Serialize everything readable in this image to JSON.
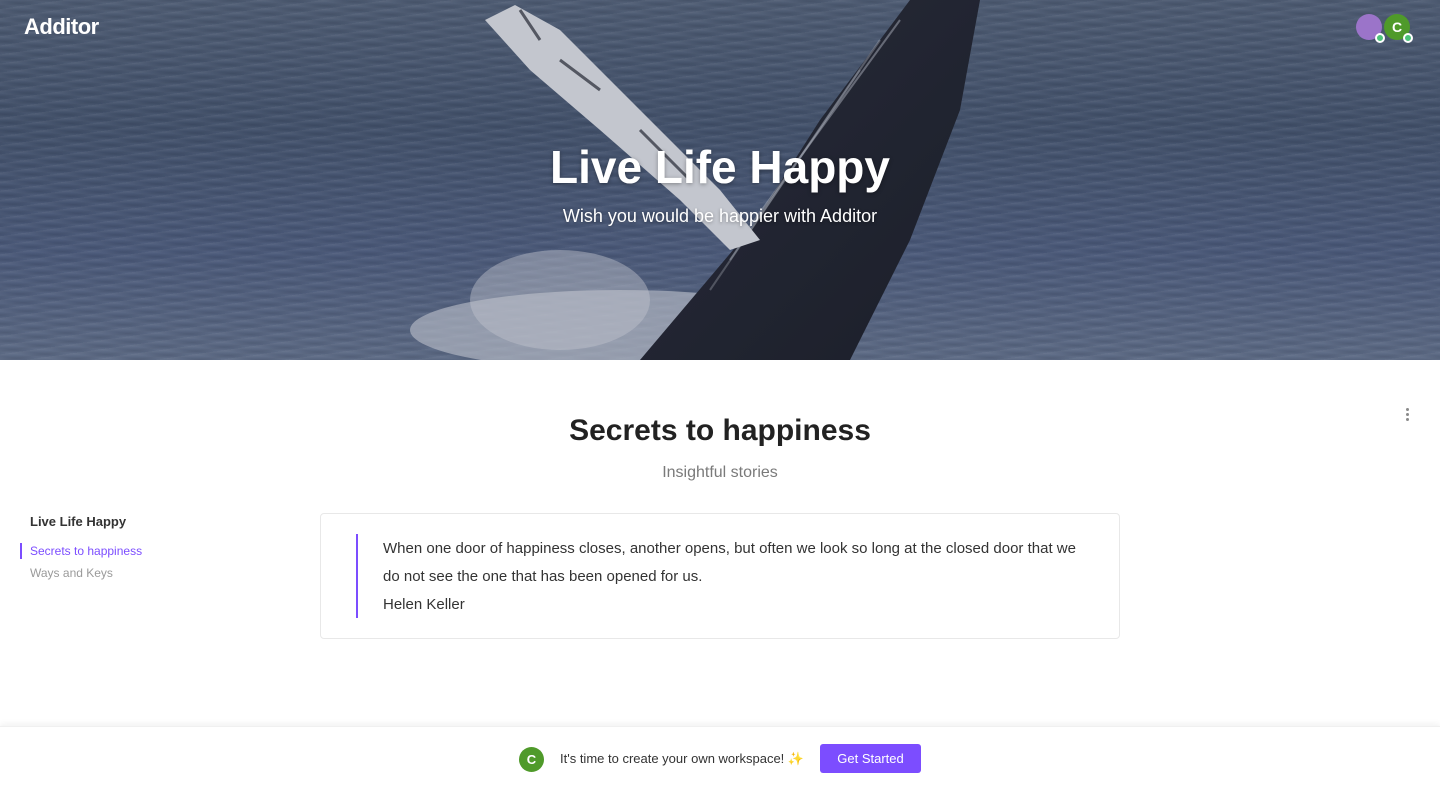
{
  "header": {
    "logo": "Additor",
    "avatars": [
      {
        "initial": "",
        "color": "#9b74c9"
      },
      {
        "initial": "C",
        "color": "#4f9a2a"
      }
    ]
  },
  "hero": {
    "title": "Live Life Happy",
    "subtitle": "Wish you would be happier with Additor"
  },
  "page": {
    "title": "Secrets to happiness",
    "subtitle": "Insightful stories",
    "menu_icon": "more-vertical-icon"
  },
  "toc": {
    "heading": "Live Life Happy",
    "items": [
      {
        "label": "Secrets to happiness",
        "active": true
      },
      {
        "label": "Ways and Keys",
        "active": false
      }
    ]
  },
  "quote": {
    "text": "When one door of happiness closes, another opens, but often we look so long at the closed door that we do not see the one that has been opened for us.",
    "author": "Helen Keller"
  },
  "bottom_bar": {
    "avatar_initial": "C",
    "message": "It's time to create your own workspace! ✨",
    "button_label": "Get Started"
  },
  "colors": {
    "accent": "#7c4dff",
    "avatar_green": "#4f9a2a"
  }
}
